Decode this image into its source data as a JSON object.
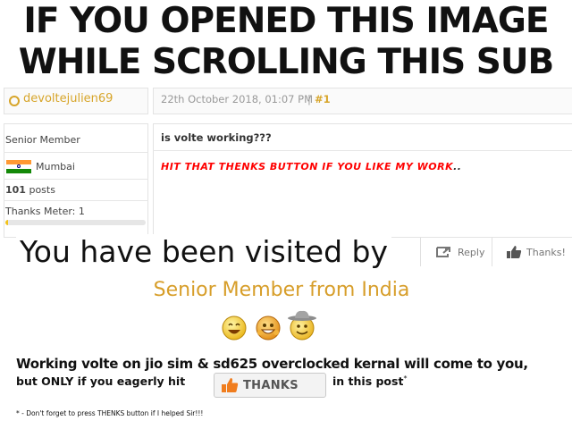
{
  "meme": {
    "headline_line1": "IF YOU OPENED THIS IMAGE",
    "headline_line2": "WHILE SCROLLING THIS SUB",
    "visited_text": "You have been visited by",
    "visitor_title": "Senior Member from India",
    "working_line": "Working volte on jio sim & sd625 overclocked kernal will come to you,",
    "condition_line": "but ONLY if you eagerly hit",
    "thanks_button_label": "THANKS",
    "tail_text": "in this post",
    "tail_asterisk": "*",
    "footnote": "* - Don't forget to press THENKS button if I helped Sir!!!",
    "smileys": [
      "laughing-smiley-icon",
      "grinning-smiley-icon",
      "cowboy-smiley-icon"
    ]
  },
  "post": {
    "username": "devoltejulien69",
    "date": "22th October 2018, 01:07 PM",
    "separator": "|",
    "post_number": "#1",
    "rank": "Senior Member",
    "location": "Mumbai",
    "post_count": "101",
    "post_count_suffix": "posts",
    "thanks_meter_label": "Thanks Meter: 1",
    "thanks_meter_fraction": 0.02,
    "subject": "is volte working???",
    "signature": "HIT THAT THENKS BUTTON IF YOU LIKE MY WORK",
    "signature_trailing": "..",
    "reply_label": "Reply",
    "thanks_label": "Thanks!"
  },
  "colors": {
    "accent": "#d7a52a",
    "signature": "#ff0000",
    "visitor": "#d79e2a",
    "thanks_orange": "#f07d1e"
  }
}
